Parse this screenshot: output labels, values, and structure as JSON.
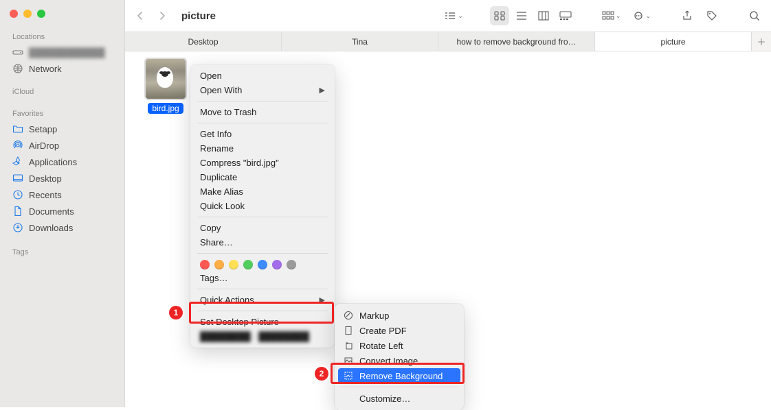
{
  "window": {
    "title": "picture"
  },
  "sidebar": {
    "sections": {
      "locations": {
        "label": "Locations",
        "items": [
          {
            "icon": "disk",
            "label": "████████████"
          },
          {
            "icon": "globe",
            "label": "Network"
          }
        ]
      },
      "icloud": {
        "label": "iCloud"
      },
      "favorites": {
        "label": "Favorites",
        "items": [
          {
            "icon": "folder",
            "label": "Setapp"
          },
          {
            "icon": "airdrop",
            "label": "AirDrop"
          },
          {
            "icon": "apps",
            "label": "Applications"
          },
          {
            "icon": "desktop",
            "label": "Desktop"
          },
          {
            "icon": "clock",
            "label": "Recents"
          },
          {
            "icon": "doc",
            "label": "Documents"
          },
          {
            "icon": "download",
            "label": "Downloads"
          }
        ]
      },
      "tags": {
        "label": "Tags"
      }
    }
  },
  "tabs": [
    {
      "label": "Desktop"
    },
    {
      "label": "Tina"
    },
    {
      "label": "how to remove background fro…"
    },
    {
      "label": "picture",
      "active": true
    }
  ],
  "file": {
    "name": "bird.jpg"
  },
  "context_menu": {
    "open": "Open",
    "open_with": "Open With",
    "move_to_trash": "Move to Trash",
    "get_info": "Get Info",
    "rename": "Rename",
    "compress": "Compress \"bird.jpg\"",
    "duplicate": "Duplicate",
    "make_alias": "Make Alias",
    "quick_look": "Quick Look",
    "copy": "Copy",
    "share": "Share…",
    "tags_colors": [
      "#ff5a52",
      "#ffad46",
      "#ffe055",
      "#51ce5e",
      "#3e8cff",
      "#a26cea",
      "#8e8e8e"
    ],
    "tags_label": "Tags…",
    "quick_actions": "Quick Actions",
    "set_desktop_picture": "Set Desktop Picture",
    "redacted": "████████ · ████████"
  },
  "quick_actions": {
    "markup": "Markup",
    "create_pdf": "Create PDF",
    "rotate_left": "Rotate Left",
    "convert_image": "Convert Image",
    "remove_background": "Remove Background",
    "customize": "Customize…"
  },
  "annotations": {
    "step1": "1",
    "step2": "2"
  }
}
